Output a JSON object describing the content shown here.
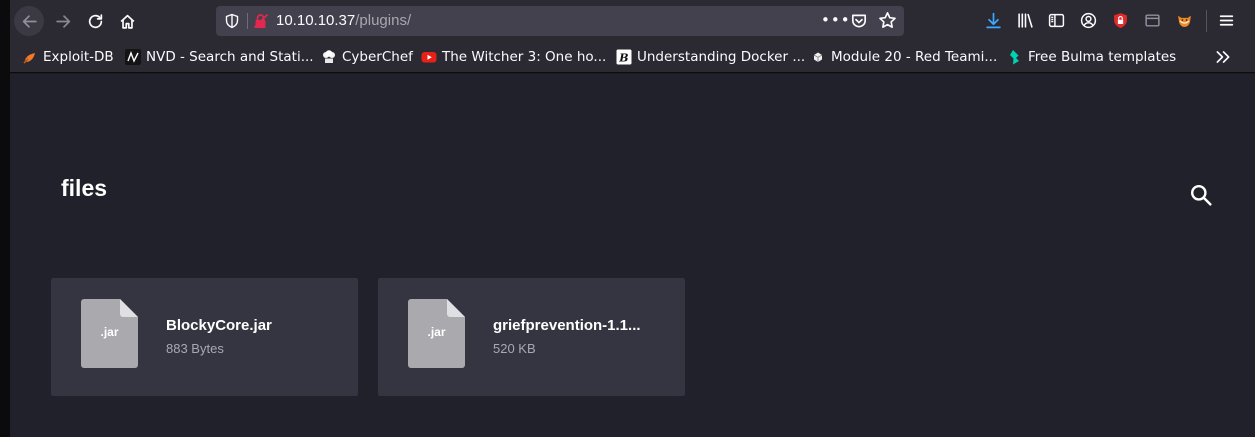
{
  "browser": {
    "url_host": "10.10.10.37",
    "url_path": "/plugins/",
    "url_actions_icon": "more-dots-icon",
    "colors": {
      "toolbar": "#2b2a33",
      "urlbar": "#42414d",
      "download": "#3ea7ff"
    }
  },
  "bookmarks": [
    {
      "label": "Exploit-DB",
      "icon": "exploit-db-icon"
    },
    {
      "label": "NVD - Search and Stati...",
      "icon": "nvd-icon"
    },
    {
      "label": "CyberChef",
      "icon": "cyberchef-icon"
    },
    {
      "label": "The Witcher 3: One ho...",
      "icon": "youtube-icon"
    },
    {
      "label": "Understanding Docker ...",
      "icon": "docker-article-icon"
    },
    {
      "label": "Module 20 - Red Teami...",
      "icon": "module-icon"
    },
    {
      "label": "Free Bulma templates",
      "icon": "bulma-icon"
    }
  ],
  "page": {
    "title": "files",
    "background": "#21212b",
    "card_color": "#353542",
    "files": [
      {
        "ext": ".jar",
        "name": "BlockyCore.jar",
        "size": "883 Bytes"
      },
      {
        "ext": ".jar",
        "name": "griefprevention-1.1...",
        "size": "520 KB"
      }
    ]
  }
}
